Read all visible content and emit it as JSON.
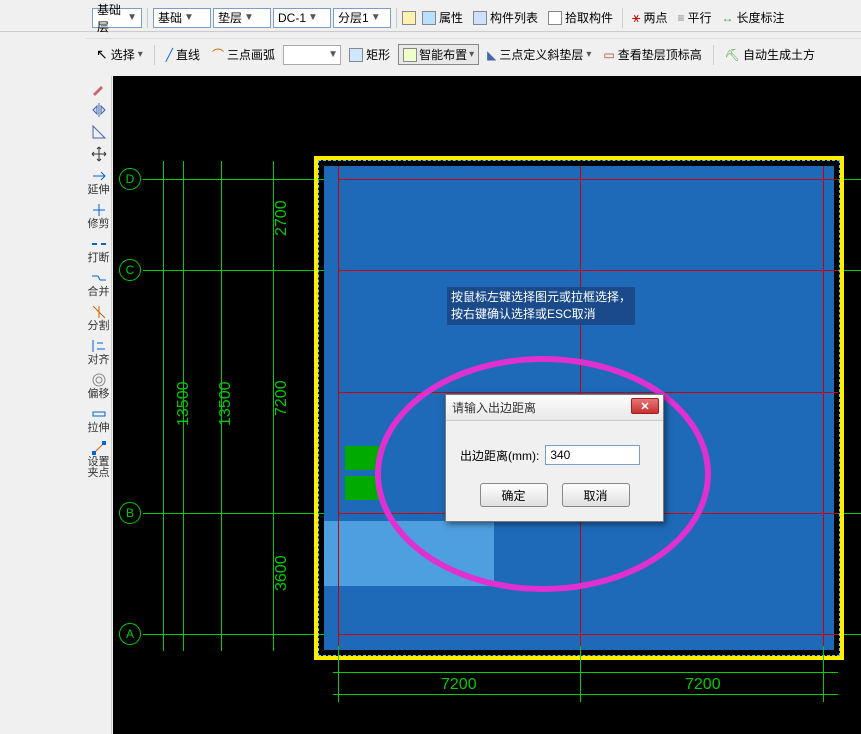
{
  "toolbar1": {
    "combo1": "基础层",
    "combo2": "基础",
    "combo3": "垫层",
    "combo4": "DC-1",
    "combo5": "分层1",
    "btn_props": "属性",
    "btn_list": "构件列表",
    "btn_pick": "拾取构件",
    "btn_2pt": "两点",
    "btn_parallel": "平行",
    "btn_len": "长度标注"
  },
  "toolbar2": {
    "select": "选择",
    "line": "直线",
    "arc3": "三点画弧",
    "rect": "矩形",
    "smart": "智能布置",
    "tri_def": "三点定义斜垫层",
    "view_top": "查看垫层顶标高",
    "auto_soil": "自动生成土方"
  },
  "left_tools": {
    "t1": "延伸",
    "t2": "修剪",
    "t3": "打断",
    "t4": "合并",
    "t5": "分割",
    "t6": "对齐",
    "t7": "偏移",
    "t8": "拉伸",
    "t9": "设置夹点"
  },
  "grid": {
    "axisA": "A",
    "axisB": "B",
    "axisC": "C",
    "axisD": "D",
    "dim2700": "2700",
    "dim7200a": "7200",
    "dim7200b": "7200",
    "dim3600": "3600",
    "dim13500a": "13500",
    "dim13500b": "13500",
    "dimH7200a": "7200",
    "dimH7200b": "7200"
  },
  "tooltip": {
    "line1": "按鼠标左键选择图元或拉框选择，",
    "line2": "按右键确认选择或ESC取消"
  },
  "dialog": {
    "title": "请输入出边距离",
    "label": "出边距离(mm):",
    "value": "340",
    "ok": "确定",
    "cancel": "取消"
  }
}
